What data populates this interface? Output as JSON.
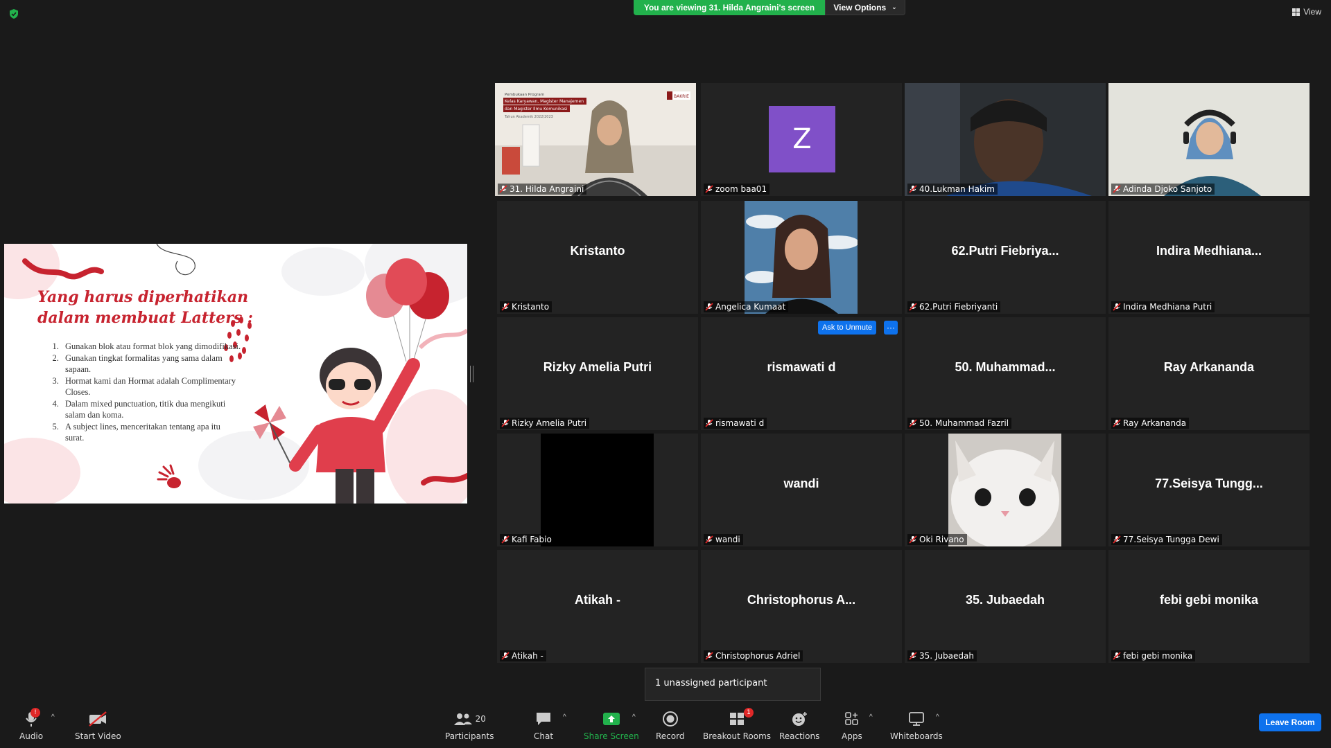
{
  "banner": {
    "viewing": "You are viewing 31. Hilda Angraini's screen",
    "view_options": "View Options",
    "view": "View"
  },
  "slide": {
    "title": "Yang harus diperhatikan dalam membuat Latters :",
    "items": [
      "Gunakan blok atau format blok yang dimodifikasi.",
      "Gunakan tingkat formalitas yang sama dalam sapaan.",
      "Hormat kami dan Hormat adalah Complimentary Closes.",
      "Dalam mixed punctuation, titik dua mengikuti salam dan koma.",
      "A subject lines, menceritakan tentang apa itu surat."
    ]
  },
  "tiles": [
    {
      "label": "31. Hilda Angraini",
      "center": "",
      "kind": "video-hilda",
      "active": true
    },
    {
      "label": "zoom baa01",
      "center": "",
      "kind": "avatar",
      "avatar": "Z"
    },
    {
      "label": "40.Lukman Hakim",
      "center": "",
      "kind": "video-lukman"
    },
    {
      "label": "Adinda Djoko Sanjoto",
      "center": "",
      "kind": "video-adinda"
    },
    {
      "label": "Kristanto",
      "center": "Kristanto"
    },
    {
      "label": "Angelica Kumaat",
      "center": "",
      "kind": "video-angelica"
    },
    {
      "label": "62.Putri Fiebriyanti",
      "center": "62.Putri  Fiebriya..."
    },
    {
      "label": "Indira Medhiana Putri",
      "center": "Indira  Medhiana..."
    },
    {
      "label": "Rizky Amelia Putri",
      "center": "Rizky Amelia Putri"
    },
    {
      "label": "rismawati d",
      "center": "rismawati d"
    },
    {
      "label": "50. Muhammad Fazril",
      "center": "50.  Muhammad..."
    },
    {
      "label": "Ray Arkananda",
      "center": "Ray Arkananda"
    },
    {
      "label": "Kafi Fabio",
      "center": "",
      "kind": "video-black"
    },
    {
      "label": "wandi",
      "center": "wandi"
    },
    {
      "label": "Oki Rivano",
      "center": "",
      "kind": "video-cat"
    },
    {
      "label": "77.Seisya Tungga Dewi",
      "center": "77.Seisya  Tungg..."
    },
    {
      "label": "Atikah -",
      "center": "Atikah -"
    },
    {
      "label": "Christophorus Adriel",
      "center": "Christophorus  A..."
    },
    {
      "label": "35. Jubaedah",
      "center": "35. Jubaedah"
    },
    {
      "label": "febi gebi monika",
      "center": "febi gebi monika"
    }
  ],
  "ask_unmute": "Ask to Unmute",
  "ask_more": "···",
  "hilda_slide": {
    "line1": "Pembukaan Program",
    "line2": "Kelas Karyawan, Magister Manajemen",
    "line3": "dan Magister Ilmu Komunikasi",
    "line4": "Tahun Akademik 2022/2023",
    "logo": "BAKRIE"
  },
  "unassigned": "1 unassigned participant",
  "toolbar": {
    "audio": "Audio",
    "start_video": "Start Video",
    "participants": "Participants",
    "participants_count": "20",
    "chat": "Chat",
    "share_screen": "Share Screen",
    "record": "Record",
    "breakout_rooms": "Breakout Rooms",
    "breakout_badge": "1",
    "reactions": "Reactions",
    "apps": "Apps",
    "whiteboards": "Whiteboards",
    "audio_badge": "!",
    "leave": "Leave Room"
  },
  "colors": {
    "active_border": "#c9ef3a",
    "green": "#22b14c",
    "blue": "#0e72ed",
    "slide_red": "#c7232f"
  }
}
